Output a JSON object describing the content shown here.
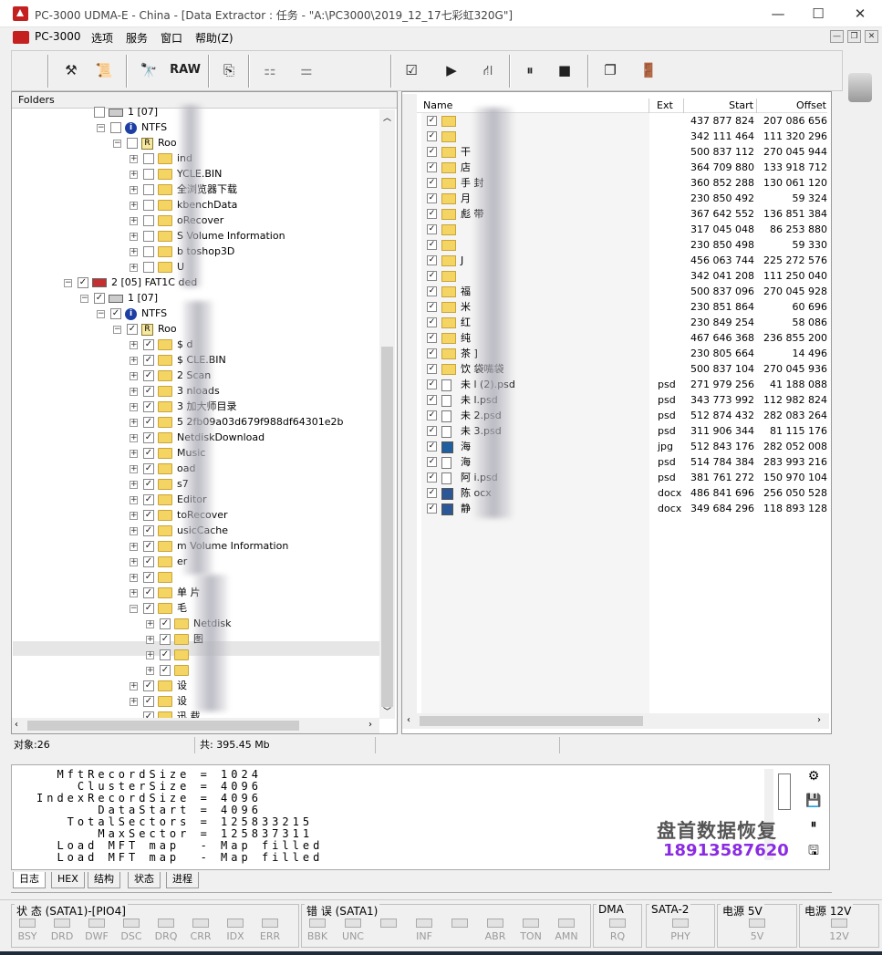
{
  "window": {
    "title": "PC-3000 UDMA-E - China - [Data Extractor : 任务 - \"A:\\PC3000\\2019_12_17七彩虹320G\"]",
    "minimize": "—",
    "maximize": "☐",
    "close": "✕"
  },
  "menu": [
    "PC-3000",
    "选项",
    "服务",
    "窗口",
    "帮助(Z)"
  ],
  "mdi": {
    "min": "—",
    "restore": "❐",
    "close": "✕"
  },
  "toolbar": {
    "raw_label": "RAW"
  },
  "folders": {
    "header": "Folders",
    "rows": [
      {
        "label": "1 [07]",
        "indent": 0,
        "exp": "",
        "cb": false,
        "icon": "disk"
      },
      {
        "label": "NTFS",
        "indent": 1,
        "exp": "−",
        "cb": false,
        "icon": "info"
      },
      {
        "label": "Roo",
        "indent": 2,
        "exp": "−",
        "cb": false,
        "icon": "root"
      },
      {
        "label": "ind",
        "indent": 3,
        "exp": "+",
        "cb": false,
        "icon": "folder"
      },
      {
        "label": "YCLE.BIN",
        "indent": 3,
        "exp": "+",
        "cb": false,
        "icon": "folder"
      },
      {
        "label": "全浏览器下载",
        "indent": 3,
        "exp": "+",
        "cb": false,
        "icon": "folder"
      },
      {
        "label": "kbenchData",
        "indent": 3,
        "exp": "+",
        "cb": false,
        "icon": "folder"
      },
      {
        "label": "oRecover",
        "indent": 3,
        "exp": "+",
        "cb": false,
        "icon": "folder"
      },
      {
        "label": "S Volume Information",
        "indent": 3,
        "exp": "+",
        "cb": false,
        "icon": "folder"
      },
      {
        "label": "b toshop3D",
        "indent": 3,
        "exp": "+",
        "cb": false,
        "icon": "folder"
      },
      {
        "label": "U",
        "indent": 3,
        "exp": "+",
        "cb": false,
        "icon": "folder"
      },
      {
        "label": "2 [05] FAT1C ded",
        "indent": -1,
        "exp": "−",
        "cb": true,
        "icon": "part"
      },
      {
        "label": "1 [07]",
        "indent": 0,
        "exp": "−",
        "cb": true,
        "icon": "disk"
      },
      {
        "label": "NTFS",
        "indent": 1,
        "exp": "−",
        "cb": true,
        "icon": "info"
      },
      {
        "label": "Roo",
        "indent": 2,
        "exp": "−",
        "cb": true,
        "icon": "root"
      },
      {
        "label": "$ d",
        "indent": 3,
        "exp": "+",
        "cb": true,
        "icon": "folder"
      },
      {
        "label": "$ CLE.BIN",
        "indent": 3,
        "exp": "+",
        "cb": true,
        "icon": "folder"
      },
      {
        "label": "2 Scan",
        "indent": 3,
        "exp": "+",
        "cb": true,
        "icon": "folder"
      },
      {
        "label": "3 nloads",
        "indent": 3,
        "exp": "+",
        "cb": true,
        "icon": "folder"
      },
      {
        "label": "3 加大师目录",
        "indent": 3,
        "exp": "+",
        "cb": true,
        "icon": "folder"
      },
      {
        "label": "5 2fb09a03d679f988df64301e2b",
        "indent": 3,
        "exp": "+",
        "cb": true,
        "icon": "folder"
      },
      {
        "label": "NetdiskDownload",
        "indent": 3,
        "exp": "+",
        "cb": true,
        "icon": "folder"
      },
      {
        "label": "Music",
        "indent": 3,
        "exp": "+",
        "cb": true,
        "icon": "folder"
      },
      {
        "label": "oad",
        "indent": 3,
        "exp": "+",
        "cb": true,
        "icon": "folder"
      },
      {
        "label": "s7",
        "indent": 3,
        "exp": "+",
        "cb": true,
        "icon": "folder"
      },
      {
        "label": "Editor",
        "indent": 3,
        "exp": "+",
        "cb": true,
        "icon": "folder"
      },
      {
        "label": "toRecover",
        "indent": 3,
        "exp": "+",
        "cb": true,
        "icon": "folder"
      },
      {
        "label": "usicCache",
        "indent": 3,
        "exp": "+",
        "cb": true,
        "icon": "folder"
      },
      {
        "label": "m Volume Information",
        "indent": 3,
        "exp": "+",
        "cb": true,
        "icon": "folder"
      },
      {
        "label": "er",
        "indent": 3,
        "exp": "+",
        "cb": true,
        "icon": "folder"
      },
      {
        "label": "",
        "indent": 3,
        "exp": "+",
        "cb": true,
        "icon": "folder"
      },
      {
        "label": "单 片",
        "indent": 3,
        "exp": "+",
        "cb": true,
        "icon": "folder"
      },
      {
        "label": "毛",
        "indent": 3,
        "exp": "−",
        "cb": true,
        "icon": "folder"
      },
      {
        "label": "Netdisk",
        "indent": 4,
        "exp": "+",
        "cb": true,
        "icon": "folder"
      },
      {
        "label": "图",
        "indent": 4,
        "exp": "+",
        "cb": true,
        "icon": "folder"
      },
      {
        "label": "",
        "indent": 4,
        "exp": "+",
        "cb": true,
        "icon": "folder"
      },
      {
        "label": "",
        "indent": 4,
        "exp": "+",
        "cb": true,
        "icon": "folder"
      },
      {
        "label": "设",
        "indent": 3,
        "exp": "+",
        "cb": true,
        "icon": "folder"
      },
      {
        "label": "设",
        "indent": 3,
        "exp": "+",
        "cb": true,
        "icon": "folder"
      },
      {
        "label": "迅 载",
        "indent": 3,
        "exp": "",
        "cb": true,
        "icon": "folder"
      }
    ]
  },
  "files": {
    "columns": {
      "name": "Name",
      "ext": "Ext",
      "start": "Start",
      "offset": "Offset"
    },
    "rows": [
      {
        "name": "",
        "ext": "",
        "start": "437 877 824",
        "offset": "207 086 656",
        "icon": "folder"
      },
      {
        "name": "",
        "ext": "",
        "start": "342 111 464",
        "offset": "111 320 296",
        "icon": "folder"
      },
      {
        "name": "干",
        "ext": "",
        "start": "500 837 112",
        "offset": "270 045 944",
        "icon": "folder"
      },
      {
        "name": "店",
        "ext": "",
        "start": "364 709 880",
        "offset": "133 918 712",
        "icon": "folder"
      },
      {
        "name": "手 封",
        "ext": "",
        "start": "360 852 288",
        "offset": "130 061 120",
        "icon": "folder"
      },
      {
        "name": "月",
        "ext": "",
        "start": "230 850 492",
        "offset": "59 324",
        "icon": "folder"
      },
      {
        "name": "彪 带",
        "ext": "",
        "start": "367 642 552",
        "offset": "136 851 384",
        "icon": "folder"
      },
      {
        "name": "",
        "ext": "",
        "start": "317 045 048",
        "offset": "86 253 880",
        "icon": "folder"
      },
      {
        "name": "",
        "ext": "",
        "start": "230 850 498",
        "offset": "59 330",
        "icon": "folder"
      },
      {
        "name": "J",
        "ext": "",
        "start": "456 063 744",
        "offset": "225 272 576",
        "icon": "folder"
      },
      {
        "name": "",
        "ext": "",
        "start": "342 041 208",
        "offset": "111 250 040",
        "icon": "folder"
      },
      {
        "name": "福",
        "ext": "",
        "start": "500 837 096",
        "offset": "270 045 928",
        "icon": "folder"
      },
      {
        "name": "米",
        "ext": "",
        "start": "230 851 864",
        "offset": "60 696",
        "icon": "folder"
      },
      {
        "name": "红",
        "ext": "",
        "start": "230 849 254",
        "offset": "58 086",
        "icon": "folder"
      },
      {
        "name": "纯",
        "ext": "",
        "start": "467 646 368",
        "offset": "236 855 200",
        "icon": "folder"
      },
      {
        "name": "茶 ]",
        "ext": "",
        "start": "230 805 664",
        "offset": "14 496",
        "icon": "folder"
      },
      {
        "name": "饮 袋嘴袋",
        "ext": "",
        "start": "500 837 104",
        "offset": "270 045 936",
        "icon": "folder"
      },
      {
        "name": "未 l (2).psd",
        "ext": "psd",
        "start": "271 979 256",
        "offset": "41 188 088",
        "icon": "file"
      },
      {
        "name": "未 l.psd",
        "ext": "psd",
        "start": "343 773 992",
        "offset": "112 982 824",
        "icon": "file"
      },
      {
        "name": "未 2.psd",
        "ext": "psd",
        "start": "512 874 432",
        "offset": "282 083 264",
        "icon": "file"
      },
      {
        "name": "未 3.psd",
        "ext": "psd",
        "start": "311 906 344",
        "offset": "81 115 176",
        "icon": "file"
      },
      {
        "name": "海",
        "ext": "jpg",
        "start": "512 843 176",
        "offset": "282 052 008",
        "icon": "jpg"
      },
      {
        "name": "海",
        "ext": "psd",
        "start": "514 784 384",
        "offset": "283 993 216",
        "icon": "file"
      },
      {
        "name": "阿 i.psd",
        "ext": "psd",
        "start": "381 761 272",
        "offset": "150 970 104",
        "icon": "file"
      },
      {
        "name": "陈 ocx",
        "ext": "docx",
        "start": "486 841 696",
        "offset": "256 050 528",
        "icon": "word"
      },
      {
        "name": "静",
        "ext": "docx",
        "start": "349 684 296",
        "offset": "118 893 128",
        "icon": "word"
      }
    ]
  },
  "status": {
    "objects": "对象:26",
    "total": "共: 395.45 Mb"
  },
  "log": {
    "lines": [
      "  MftRecordSize = 1024",
      "    ClusterSize = 4096",
      "IndexRecordSize = 4096",
      "      DataStart = 4096",
      "   TotalSectors = 125833215",
      "      MaxSector = 125837311",
      "  Load MFT map  - Map filled",
      "  Load MFT map  - Map filled"
    ]
  },
  "tabs": [
    "日志",
    "HEX",
    "结构",
    "状态",
    "进程"
  ],
  "watermark": {
    "line1": "盘首数据恢复",
    "line2": "18913587620"
  },
  "registers": {
    "groups": [
      {
        "title": "状 态 (SATA1)-[PIO4]",
        "leds": [
          "BSY",
          "DRD",
          "DWF",
          "DSC",
          "DRQ",
          "CRR",
          "IDX",
          "ERR"
        ]
      },
      {
        "title": "错 误 (SATA1)",
        "leds": [
          "BBK",
          "UNC",
          "",
          "INF",
          "",
          "ABR",
          "TON",
          "AMN"
        ]
      },
      {
        "title": "DMA",
        "leds": [
          "RQ"
        ]
      },
      {
        "title": "SATA-2",
        "leds": [
          "PHY"
        ]
      },
      {
        "title": "电源 5V",
        "leds": [
          "5V"
        ]
      },
      {
        "title": "电源 12V",
        "leds": [
          "12V"
        ]
      }
    ]
  }
}
